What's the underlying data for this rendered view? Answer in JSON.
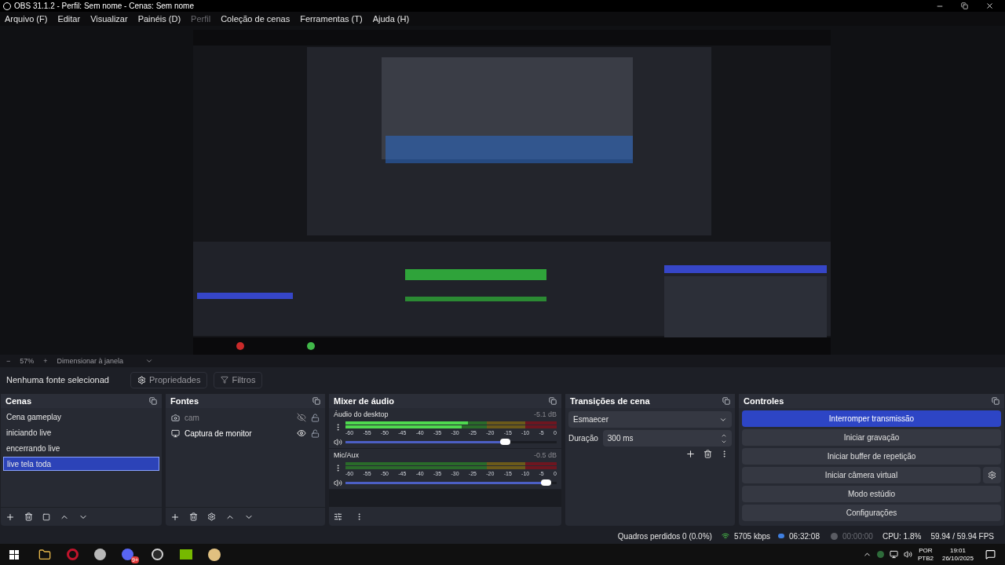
{
  "window": {
    "title": "OBS 31.1.2 - Perfil: Sem nome - Cenas: Sem nome"
  },
  "menu": [
    {
      "label": "Arquivo (F)",
      "disabled": false
    },
    {
      "label": "Editar",
      "disabled": false
    },
    {
      "label": "Visualizar",
      "disabled": false
    },
    {
      "label": "Painéis (D)",
      "disabled": false
    },
    {
      "label": "Perfil",
      "disabled": true
    },
    {
      "label": "Coleção de cenas",
      "disabled": false
    },
    {
      "label": "Ferramentas (T)",
      "disabled": false
    },
    {
      "label": "Ajuda (H)",
      "disabled": false
    }
  ],
  "zoom_bar": {
    "minus": "−",
    "zoom": "57%",
    "plus": "+",
    "scale_mode": "Dimensionar à janela"
  },
  "source_toolbar": {
    "status": "Nenhuma fonte selecionad",
    "properties": "Propriedades",
    "filters": "Filtros"
  },
  "scenes": {
    "title": "Cenas",
    "items": [
      {
        "label": "Cena gameplay",
        "selected": false
      },
      {
        "label": "iniciando live",
        "selected": false
      },
      {
        "label": "encerrando live",
        "selected": false
      },
      {
        "label": "live tela toda",
        "selected": true
      }
    ]
  },
  "sources": {
    "title": "Fontes",
    "items": [
      {
        "label": "cam",
        "kind": "camera",
        "visible": false,
        "locked": false
      },
      {
        "label": "Captura de monitor",
        "kind": "monitor",
        "visible": true,
        "locked": false
      }
    ]
  },
  "mixer": {
    "title": "Mixer de áudio",
    "channels": [
      {
        "name": "Áudio do desktop",
        "reading": "-5.1 dB",
        "meters": [
          {
            "level": 0.58
          },
          {
            "level": 0.55
          }
        ],
        "scale": [
          "-60",
          "-55",
          "-50",
          "-45",
          "-40",
          "-35",
          "-30",
          "-25",
          "-20",
          "-15",
          "-10",
          "-5",
          "0"
        ],
        "level": 0.76
      },
      {
        "name": "Mic/Aux",
        "reading": "-0.5 dB",
        "meters": [
          {
            "level": 0
          },
          {
            "level": 0
          }
        ],
        "scale": [
          "-60",
          "-55",
          "-50",
          "-45",
          "-40",
          "-35",
          "-30",
          "-25",
          "-20",
          "-15",
          "-10",
          "-5",
          "0"
        ],
        "level": 0.95
      }
    ]
  },
  "transitions": {
    "title": "Transições de cena",
    "transition": "Esmaecer",
    "duration_label": "Duração",
    "duration": "300 ms"
  },
  "controls": {
    "title": "Controles",
    "buttons": [
      {
        "label": "Interromper transmissão",
        "active": true,
        "gear": false
      },
      {
        "label": "Iniciar gravação",
        "active": false,
        "gear": false
      },
      {
        "label": "Iniciar buffer de repetição",
        "active": false,
        "gear": false
      },
      {
        "label": "Iniciar câmera virtual",
        "active": false,
        "gear": true
      },
      {
        "label": "Modo estúdio",
        "active": false,
        "gear": false
      },
      {
        "label": "Configurações",
        "active": false,
        "gear": false
      }
    ]
  },
  "status_bar": {
    "dropped": "Quadros perdidos 0 (0.0%)",
    "bitrate": "5705 kbps",
    "stream_time": "06:32:08",
    "recording": false,
    "record_time": "00:00:00",
    "cpu": "CPU: 1.8%",
    "fps": "59.94 / 59.94 FPS"
  },
  "taskbar": {
    "discord_badge": "9+",
    "language": "POR",
    "layout": "PTB2",
    "time": "19:01",
    "date": "26/10/2025"
  }
}
